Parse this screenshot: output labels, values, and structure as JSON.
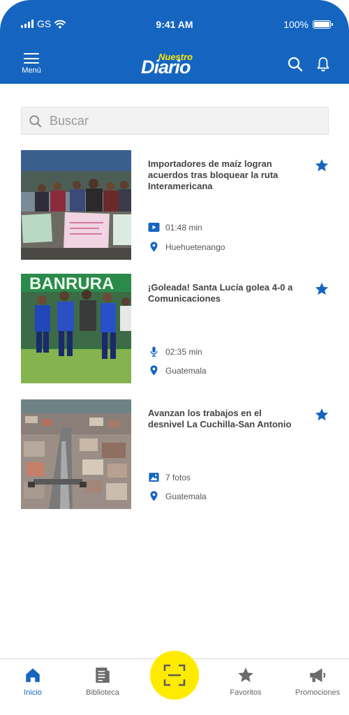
{
  "status_bar": {
    "carrier": "GS",
    "time": "9:41 AM",
    "battery": "100%"
  },
  "header": {
    "menu_label": "Menú",
    "logo_small": "Nuestro",
    "logo_big": "Diario"
  },
  "search": {
    "placeholder": "Buscar"
  },
  "articles": [
    {
      "title": "Importadores de maíz logran acuerdos tras bloquear la ruta Interamericana",
      "media_icon": "video-icon",
      "media_text": "01:48 min",
      "location": "Huehuetenango",
      "favorite": true
    },
    {
      "title": "¡Goleada! Santa Lucía golea 4-0 a Comunicaciones",
      "media_icon": "microphone-icon",
      "media_text": "02:35 min",
      "location": "Guatemala",
      "favorite": true
    },
    {
      "title": "Avanzan los trabajos en el desnivel La Cuchilla-San Antonio",
      "media_icon": "image-icon",
      "media_text": "7 fotos",
      "location": "Guatemala",
      "favorite": true
    }
  ],
  "bottom_nav": {
    "items": [
      {
        "label": "Inicio",
        "icon": "home-icon",
        "active": true
      },
      {
        "label": "Biblioteca",
        "icon": "newspaper-icon",
        "active": false
      },
      {
        "label": "",
        "icon": "scan-icon",
        "active": false
      },
      {
        "label": "Favoritos",
        "icon": "star-icon",
        "active": false
      },
      {
        "label": "Promociones",
        "icon": "megaphone-icon",
        "active": false
      }
    ]
  },
  "colors": {
    "primary": "#1565c0",
    "accent_yellow": "#ffeb00",
    "logo_yellow": "#ffe600",
    "text_dark": "#444444"
  }
}
